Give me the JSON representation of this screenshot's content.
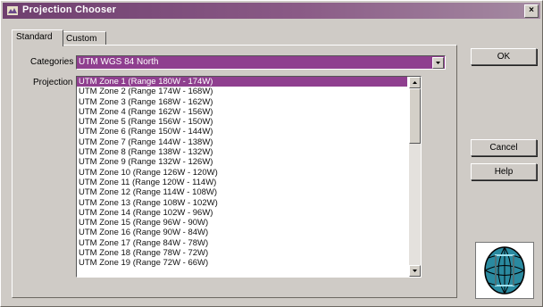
{
  "window": {
    "title": "Projection Chooser",
    "close_label": "×"
  },
  "tabs": [
    {
      "label": "Standard"
    },
    {
      "label": "Custom"
    }
  ],
  "categories": {
    "label": "Categories",
    "value": "UTM WGS 84 North"
  },
  "projection": {
    "label": "Projection",
    "items": [
      "UTM Zone 1  (Range 180W - 174W)",
      "UTM Zone 2  (Range 174W - 168W)",
      "UTM Zone 3  (Range 168W - 162W)",
      "UTM Zone 4  (Range 162W - 156W)",
      "UTM Zone 5  (Range 156W - 150W)",
      "UTM Zone 6  (Range 150W - 144W)",
      "UTM Zone 7  (Range 144W - 138W)",
      "UTM Zone 8  (Range 138W - 132W)",
      "UTM Zone 9  (Range 132W - 126W)",
      "UTM Zone 10 (Range 126W - 120W)",
      "UTM Zone 11 (Range 120W - 114W)",
      "UTM Zone 12 (Range 114W - 108W)",
      "UTM Zone 13 (Range 108W - 102W)",
      "UTM Zone 14 (Range 102W - 96W)",
      "UTM Zone 15 (Range 96W - 90W)",
      "UTM Zone 16 (Range 90W - 84W)",
      "UTM Zone 17 (Range 84W - 78W)",
      "UTM Zone 18 (Range 78W - 72W)",
      "UTM Zone 19 (Range 72W - 66W)"
    ],
    "selected_index": 0
  },
  "buttons": {
    "ok": "OK",
    "cancel": "Cancel",
    "help": "Help"
  },
  "icons": {
    "app": "projection-app-icon",
    "globe": "globe-projection-icon",
    "dropdown": "chevron-down-icon"
  },
  "colors": {
    "selection": "#8f3f8f",
    "title_bar": "#6f3f6f"
  }
}
